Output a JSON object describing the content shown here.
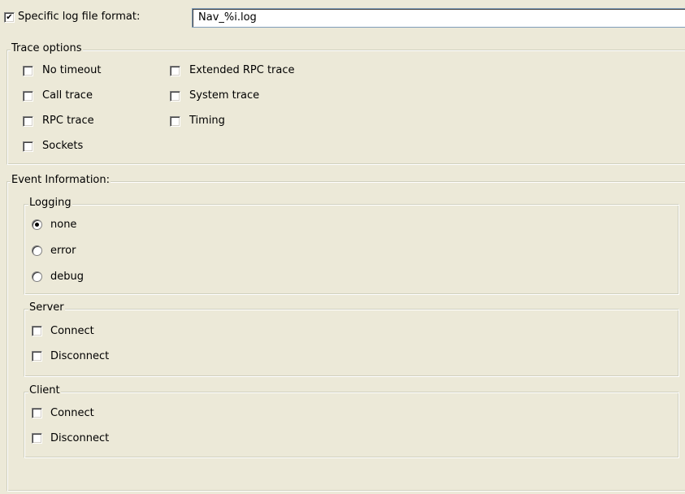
{
  "log_format": {
    "checked": true,
    "label": "Specific log file format:",
    "value": "Nav_%i.log"
  },
  "trace_options": {
    "title": "Trace options",
    "col1": [
      {
        "label": "No timeout",
        "checked": false
      },
      {
        "label": "Call trace",
        "checked": false
      },
      {
        "label": "RPC trace",
        "checked": false
      },
      {
        "label": "Sockets",
        "checked": false
      }
    ],
    "col2": [
      {
        "label": "Extended RPC trace",
        "checked": false
      },
      {
        "label": "System trace",
        "checked": false
      },
      {
        "label": "Timing",
        "checked": false
      }
    ]
  },
  "event_info": {
    "title": "Event Information:",
    "logging": {
      "title": "Logging",
      "options": [
        {
          "label": "none",
          "selected": true
        },
        {
          "label": "error",
          "selected": false
        },
        {
          "label": "debug",
          "selected": false
        }
      ]
    },
    "server": {
      "title": "Server",
      "items": [
        {
          "label": "Connect",
          "checked": false
        },
        {
          "label": "Disconnect",
          "checked": false
        }
      ]
    },
    "client": {
      "title": "Client",
      "items": [
        {
          "label": "Connect",
          "checked": false
        },
        {
          "label": "Disconnect",
          "checked": false
        }
      ]
    }
  },
  "glyphs": {
    "check": "✔"
  }
}
